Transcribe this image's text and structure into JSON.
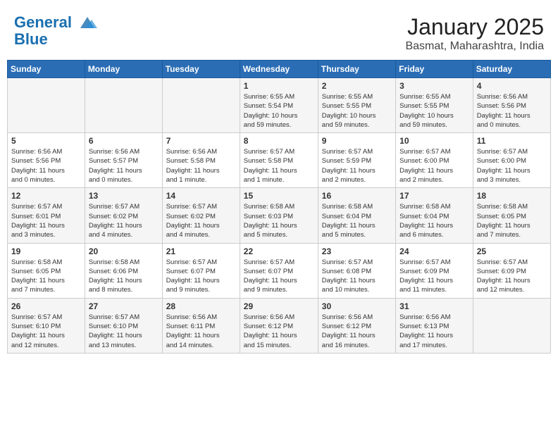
{
  "header": {
    "logo_line1": "General",
    "logo_line2": "Blue",
    "title": "January 2025",
    "subtitle": "Basmat, Maharashtra, India"
  },
  "weekdays": [
    "Sunday",
    "Monday",
    "Tuesday",
    "Wednesday",
    "Thursday",
    "Friday",
    "Saturday"
  ],
  "weeks": [
    [
      {
        "day": "",
        "info": ""
      },
      {
        "day": "",
        "info": ""
      },
      {
        "day": "",
        "info": ""
      },
      {
        "day": "1",
        "info": "Sunrise: 6:55 AM\nSunset: 5:54 PM\nDaylight: 10 hours\nand 59 minutes."
      },
      {
        "day": "2",
        "info": "Sunrise: 6:55 AM\nSunset: 5:55 PM\nDaylight: 10 hours\nand 59 minutes."
      },
      {
        "day": "3",
        "info": "Sunrise: 6:55 AM\nSunset: 5:55 PM\nDaylight: 10 hours\nand 59 minutes."
      },
      {
        "day": "4",
        "info": "Sunrise: 6:56 AM\nSunset: 5:56 PM\nDaylight: 11 hours\nand 0 minutes."
      }
    ],
    [
      {
        "day": "5",
        "info": "Sunrise: 6:56 AM\nSunset: 5:56 PM\nDaylight: 11 hours\nand 0 minutes."
      },
      {
        "day": "6",
        "info": "Sunrise: 6:56 AM\nSunset: 5:57 PM\nDaylight: 11 hours\nand 0 minutes."
      },
      {
        "day": "7",
        "info": "Sunrise: 6:56 AM\nSunset: 5:58 PM\nDaylight: 11 hours\nand 1 minute."
      },
      {
        "day": "8",
        "info": "Sunrise: 6:57 AM\nSunset: 5:58 PM\nDaylight: 11 hours\nand 1 minute."
      },
      {
        "day": "9",
        "info": "Sunrise: 6:57 AM\nSunset: 5:59 PM\nDaylight: 11 hours\nand 2 minutes."
      },
      {
        "day": "10",
        "info": "Sunrise: 6:57 AM\nSunset: 6:00 PM\nDaylight: 11 hours\nand 2 minutes."
      },
      {
        "day": "11",
        "info": "Sunrise: 6:57 AM\nSunset: 6:00 PM\nDaylight: 11 hours\nand 3 minutes."
      }
    ],
    [
      {
        "day": "12",
        "info": "Sunrise: 6:57 AM\nSunset: 6:01 PM\nDaylight: 11 hours\nand 3 minutes."
      },
      {
        "day": "13",
        "info": "Sunrise: 6:57 AM\nSunset: 6:02 PM\nDaylight: 11 hours\nand 4 minutes."
      },
      {
        "day": "14",
        "info": "Sunrise: 6:57 AM\nSunset: 6:02 PM\nDaylight: 11 hours\nand 4 minutes."
      },
      {
        "day": "15",
        "info": "Sunrise: 6:58 AM\nSunset: 6:03 PM\nDaylight: 11 hours\nand 5 minutes."
      },
      {
        "day": "16",
        "info": "Sunrise: 6:58 AM\nSunset: 6:04 PM\nDaylight: 11 hours\nand 5 minutes."
      },
      {
        "day": "17",
        "info": "Sunrise: 6:58 AM\nSunset: 6:04 PM\nDaylight: 11 hours\nand 6 minutes."
      },
      {
        "day": "18",
        "info": "Sunrise: 6:58 AM\nSunset: 6:05 PM\nDaylight: 11 hours\nand 7 minutes."
      }
    ],
    [
      {
        "day": "19",
        "info": "Sunrise: 6:58 AM\nSunset: 6:05 PM\nDaylight: 11 hours\nand 7 minutes."
      },
      {
        "day": "20",
        "info": "Sunrise: 6:58 AM\nSunset: 6:06 PM\nDaylight: 11 hours\nand 8 minutes."
      },
      {
        "day": "21",
        "info": "Sunrise: 6:57 AM\nSunset: 6:07 PM\nDaylight: 11 hours\nand 9 minutes."
      },
      {
        "day": "22",
        "info": "Sunrise: 6:57 AM\nSunset: 6:07 PM\nDaylight: 11 hours\nand 9 minutes."
      },
      {
        "day": "23",
        "info": "Sunrise: 6:57 AM\nSunset: 6:08 PM\nDaylight: 11 hours\nand 10 minutes."
      },
      {
        "day": "24",
        "info": "Sunrise: 6:57 AM\nSunset: 6:09 PM\nDaylight: 11 hours\nand 11 minutes."
      },
      {
        "day": "25",
        "info": "Sunrise: 6:57 AM\nSunset: 6:09 PM\nDaylight: 11 hours\nand 12 minutes."
      }
    ],
    [
      {
        "day": "26",
        "info": "Sunrise: 6:57 AM\nSunset: 6:10 PM\nDaylight: 11 hours\nand 12 minutes."
      },
      {
        "day": "27",
        "info": "Sunrise: 6:57 AM\nSunset: 6:10 PM\nDaylight: 11 hours\nand 13 minutes."
      },
      {
        "day": "28",
        "info": "Sunrise: 6:56 AM\nSunset: 6:11 PM\nDaylight: 11 hours\nand 14 minutes."
      },
      {
        "day": "29",
        "info": "Sunrise: 6:56 AM\nSunset: 6:12 PM\nDaylight: 11 hours\nand 15 minutes."
      },
      {
        "day": "30",
        "info": "Sunrise: 6:56 AM\nSunset: 6:12 PM\nDaylight: 11 hours\nand 16 minutes."
      },
      {
        "day": "31",
        "info": "Sunrise: 6:56 AM\nSunset: 6:13 PM\nDaylight: 11 hours\nand 17 minutes."
      },
      {
        "day": "",
        "info": ""
      }
    ]
  ]
}
